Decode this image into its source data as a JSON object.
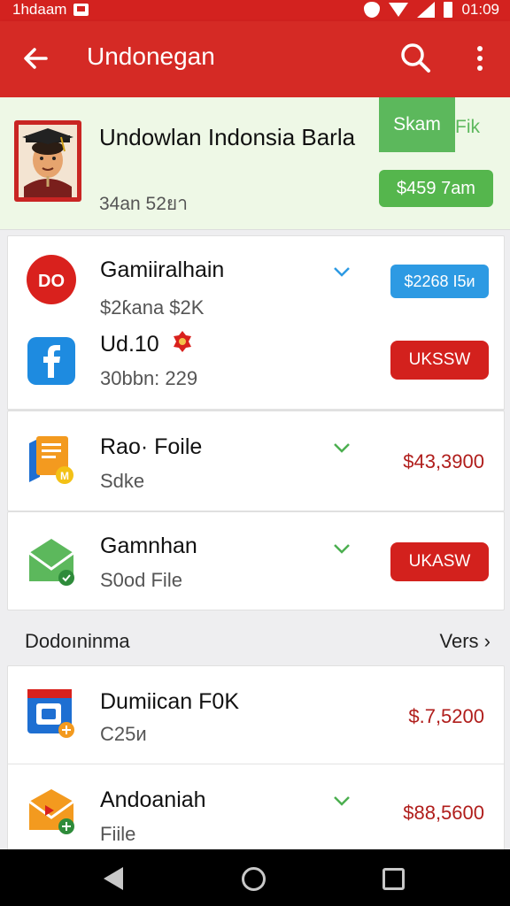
{
  "status_bar": {
    "left_text": "1hdaam",
    "time": "01:09"
  },
  "app_bar": {
    "title": "Undonegan"
  },
  "profile": {
    "name": "Undowlan Indonsia Barla",
    "subtitle": "34an 52ยา",
    "tag_label": "Skam",
    "tag_label_2": "Fik",
    "price_button": "$459 7am"
  },
  "card1": {
    "items": [
      {
        "title": "Gamiiralhain",
        "subtitle": "$2ƙana $2K",
        "action": "$2268 I5ᴎ"
      },
      {
        "title": "Ud.10",
        "subtitle": "30bbn: 229",
        "action": "UKSSW"
      }
    ]
  },
  "card2": {
    "title": "Rao· Foile",
    "subtitle": "Sdke",
    "price": "$43,3900"
  },
  "card3": {
    "title": "Gamnhan",
    "subtitle": "S0od File",
    "action": "UKASW"
  },
  "section": {
    "label": "Dodoıninma",
    "more": "Vers ›"
  },
  "card4": {
    "items": [
      {
        "title": "Dumiican F0K",
        "subtitle": "C25ᴎ",
        "price": "$.7,5200"
      },
      {
        "title": "Andoaniah",
        "subtitle": "Fiile",
        "price": "$88,5600"
      }
    ]
  },
  "colors": {
    "primary": "#d52a25",
    "green": "#55b64d",
    "blue": "#2d9ae3",
    "price": "#b01d1b"
  }
}
